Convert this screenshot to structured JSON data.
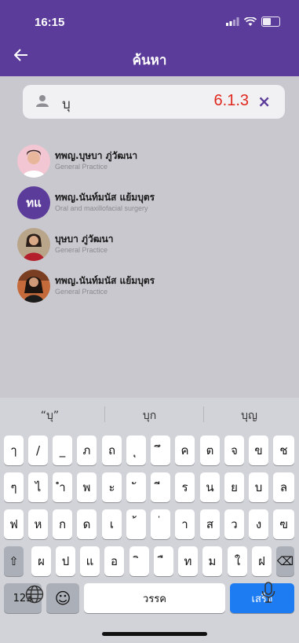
{
  "status": {
    "time": "16:15"
  },
  "header": {
    "title": "ค้นหา"
  },
  "search": {
    "query": "บุ",
    "version": "6.1.3",
    "clear_label": "×"
  },
  "results": [
    {
      "name": "ทพญ.บุษบา ภู่วัฒนา",
      "specialty": "General Practice",
      "avatar": "photo"
    },
    {
      "name": "ทพญ.นันท์มนัส แย้มบุตร",
      "specialty": "Oral and maxillofacial surgery",
      "avatar": "initials",
      "initials": "ทแ"
    },
    {
      "name": "บุษบา ภู่วัฒนา",
      "specialty": "General Practice",
      "avatar": "photo"
    },
    {
      "name": "ทพญ.นันท์มนัส แย้มบุตร",
      "specialty": "General Practice",
      "avatar": "photo"
    }
  ],
  "keyboard": {
    "suggestions": [
      "“บุ”",
      "บุก",
      "บุญ"
    ],
    "row1": [
      "ๅ",
      "/",
      "_",
      "ภ",
      "ถ",
      "ุ",
      "ึ",
      "ค",
      "ต",
      "จ",
      "ข",
      "ช"
    ],
    "row2": [
      "ๆ",
      "ไ",
      "ำ",
      "พ",
      "ะ",
      "ั",
      "ี",
      "ร",
      "น",
      "ย",
      "บ",
      "ล"
    ],
    "row3": [
      "ฟ",
      "ห",
      "ก",
      "ด",
      "เ",
      "้",
      "่",
      "า",
      "ส",
      "ว",
      "ง",
      "ฃ"
    ],
    "row4": [
      "ผ",
      "ป",
      "แ",
      "อ",
      "ิ",
      "ื",
      "ท",
      "ม",
      "ใ",
      "ฝ"
    ],
    "shift": "⇧",
    "backspace": "⌫",
    "numbers_label": "123",
    "emoji": "☺",
    "space_label": "วรรค",
    "done_label": "เสร็จ",
    "globe": "globe-icon",
    "mic": "mic-icon"
  }
}
